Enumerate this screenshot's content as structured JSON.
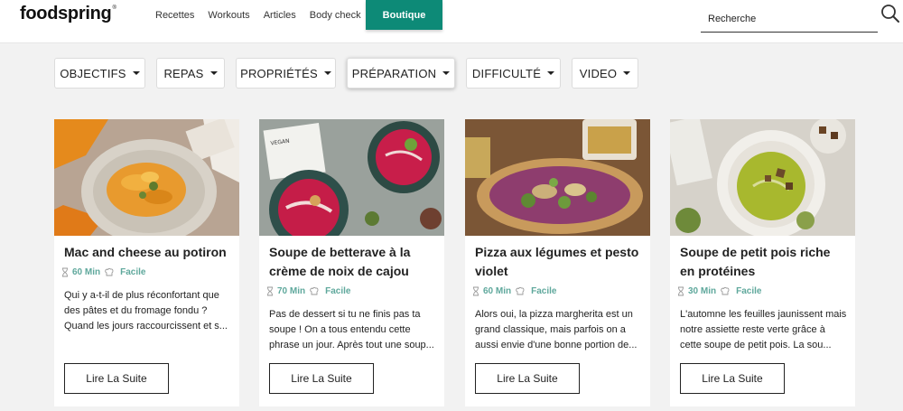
{
  "header": {
    "logo": "foodspring",
    "logo_mark": "®",
    "nav": [
      "Recettes",
      "Workouts",
      "Articles",
      "Body check"
    ],
    "boutique_label": "Boutique",
    "search_placeholder": "Recherche"
  },
  "filters": [
    "OBJECTIFS",
    "REPAS",
    "PROPRIÉTÉS",
    "PRÉPARATION",
    "DIFFICULTÉ",
    "VIDEO"
  ],
  "cards": [
    {
      "title": "Mac and cheese au potiron",
      "time": "60 Min",
      "difficulty": "Facile",
      "description": "Qui y a-t-il de plus réconfortant que des pâtes et du fromage fondu ? Quand les jours raccourcissent et s...",
      "button": "Lire La Suite"
    },
    {
      "title": "Soupe de betterave à la crème de noix de cajou",
      "time": "70 Min",
      "difficulty": "Facile",
      "description": "Pas de dessert si tu ne finis pas ta soupe ! On a tous entendu cette phrase un jour. Après tout une soup...",
      "button": "Lire La Suite"
    },
    {
      "title": "Pizza aux légumes et pesto violet",
      "time": "60 Min",
      "difficulty": "Facile",
      "description": "Alors oui, la pizza margherita est un grand classique, mais parfois on a aussi envie d'une bonne portion de...",
      "button": "Lire La Suite"
    },
    {
      "title": "Soupe de petit pois riche en protéines",
      "time": "30 Min",
      "difficulty": "Facile",
      "description": "L'automne les feuilles jaunissent mais notre assiette reste verte grâce à cette soupe de petit pois. La sou...",
      "button": "Lire La Suite"
    }
  ],
  "colors": {
    "accent": "#0d8a77",
    "meta": "#5fa89c"
  },
  "icons": {
    "search": "search-icon",
    "time": "hourglass-icon",
    "difficulty": "chef-hat-icon",
    "filter_caret": "caret-down-icon"
  }
}
